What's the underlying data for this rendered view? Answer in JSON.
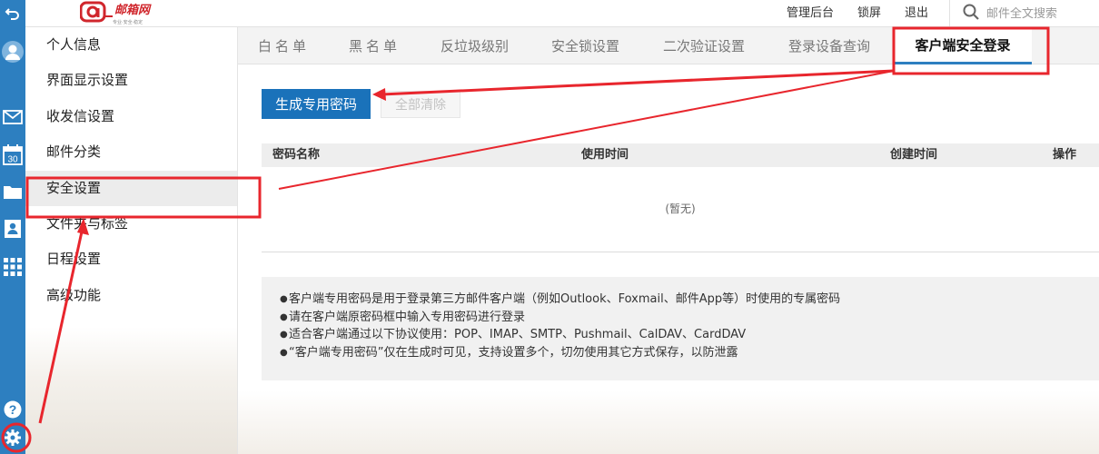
{
  "header": {
    "logo_text": "邮箱网",
    "logo_tagline": "专业·安全·稳定",
    "links": [
      "管理后台",
      "锁屏",
      "退出"
    ],
    "search_placeholder": "邮件全文搜索",
    "search_icon": "search-icon"
  },
  "rail": {
    "icons": [
      "back-icon",
      "avatar-icon",
      "mail-icon",
      "calendar-icon",
      "folder-icon",
      "contacts-icon",
      "apps-icon",
      "help-icon",
      "settings-icon"
    ],
    "calendar_day": "30",
    "background": "#2d7fc0"
  },
  "sidebar": {
    "items": [
      {
        "label": "个人信息"
      },
      {
        "label": "界面显示设置"
      },
      {
        "label": "收发信设置"
      },
      {
        "label": "邮件分类"
      },
      {
        "label": "安全设置",
        "active": true
      },
      {
        "label": "文件夹与标签"
      },
      {
        "label": "日程设置"
      },
      {
        "label": "高级功能"
      }
    ]
  },
  "tabs": [
    {
      "label": "白名单"
    },
    {
      "label": "黑名单"
    },
    {
      "label": "反垃圾级别"
    },
    {
      "label": "安全锁设置"
    },
    {
      "label": "二次验证设置"
    },
    {
      "label": "登录设备查询"
    },
    {
      "label": "客户端安全登录",
      "active": true
    }
  ],
  "actions": {
    "generate_label": "生成专用密码",
    "clear_label": "全部清除"
  },
  "table": {
    "columns": [
      "密码名称",
      "使用时间",
      "创建时间",
      "操作"
    ],
    "rows": [],
    "empty_text": "(暂无)"
  },
  "notes": [
    "客户端专用密码是用于登录第三方邮件客户端（例如Outlook、Foxmail、邮件App等）时使用的专属密码",
    "请在客户端原密码框中输入专用密码进行登录",
    "适合客户端通过以下协议使用：POP、IMAP、SMTP、Pushmail、CalDAV、CardDAV",
    "“客户端专用密码”仅在生成时可见，支持设置多个，切勿使用其它方式保存，以防泄露"
  ],
  "colors": {
    "accent": "#2d7fc0",
    "primary_button": "#1a72ba",
    "annotation": "#e8262d"
  }
}
